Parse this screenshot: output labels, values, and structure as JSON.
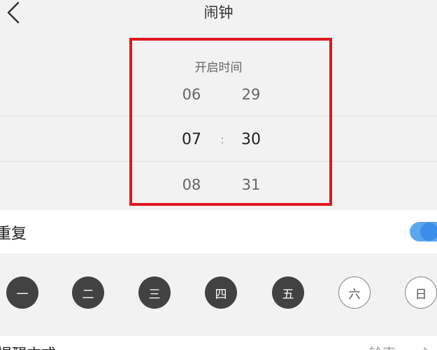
{
  "header": {
    "title": "闹钟",
    "back_icon": "chevron-left-icon"
  },
  "picker": {
    "label": "开启时间",
    "hours": {
      "above": "06",
      "selected": "07",
      "below": "08"
    },
    "minutes": {
      "above": "29",
      "selected": "30",
      "below": "31"
    },
    "separator": ":"
  },
  "highlight_color": "#e0171f",
  "repeat": {
    "label": "重复",
    "enabled": true,
    "toggle_color": "#3a8de8"
  },
  "days": [
    {
      "label": "一",
      "selected": true
    },
    {
      "label": "二",
      "selected": true
    },
    {
      "label": "三",
      "selected": true
    },
    {
      "label": "四",
      "selected": true
    },
    {
      "label": "五",
      "selected": true
    },
    {
      "label": "六",
      "selected": false
    },
    {
      "label": "日",
      "selected": false
    }
  ],
  "bottom": {
    "left_label": "提醒方式",
    "right_value": "铃声",
    "chevron_icon": "chevron-right-icon"
  }
}
